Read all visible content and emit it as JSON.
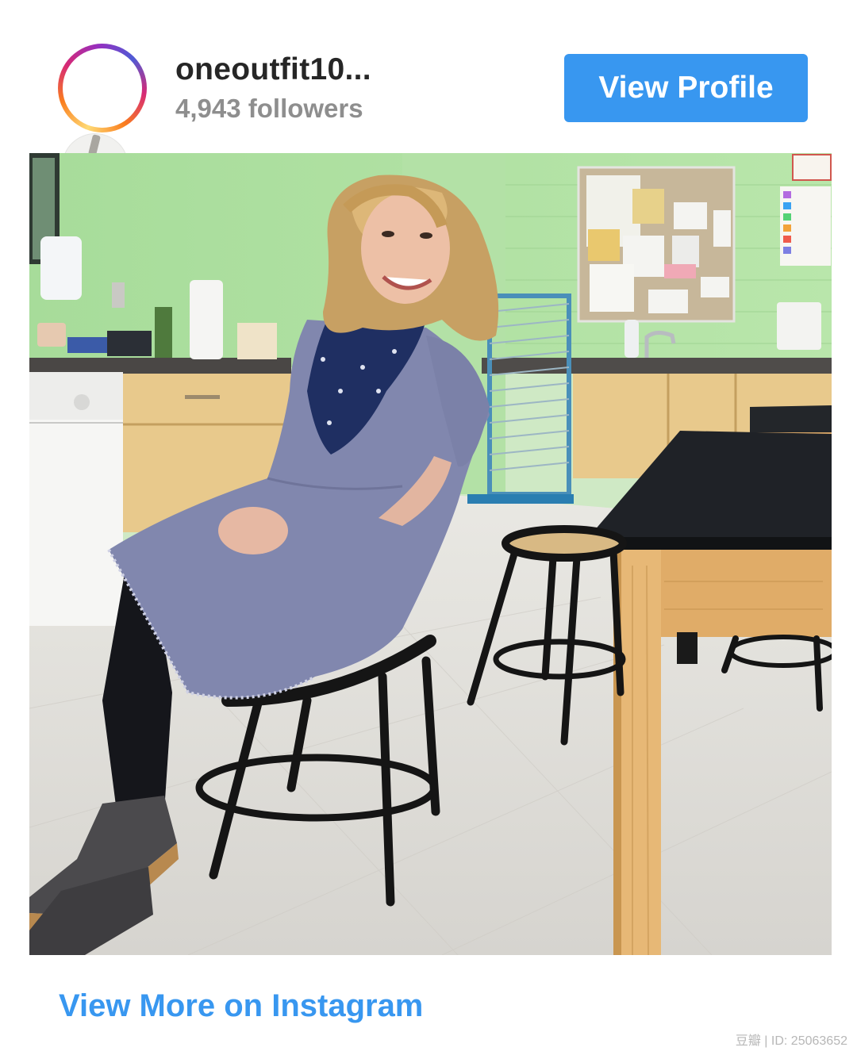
{
  "embed": {
    "username": "oneoutfit10...",
    "followers": "4,943 followers",
    "view_profile_label": "View Profile",
    "view_more_label": "View More on Instagram"
  },
  "post": {
    "image_alt": "Woman in a gray dress and scarf sitting on a stool in a classroom"
  },
  "watermark": {
    "text": "豆瓣 | ID: 25063652"
  },
  "colors": {
    "accent": "#3897f0",
    "username": "#262626",
    "secondary_text": "#8e8e8e"
  }
}
